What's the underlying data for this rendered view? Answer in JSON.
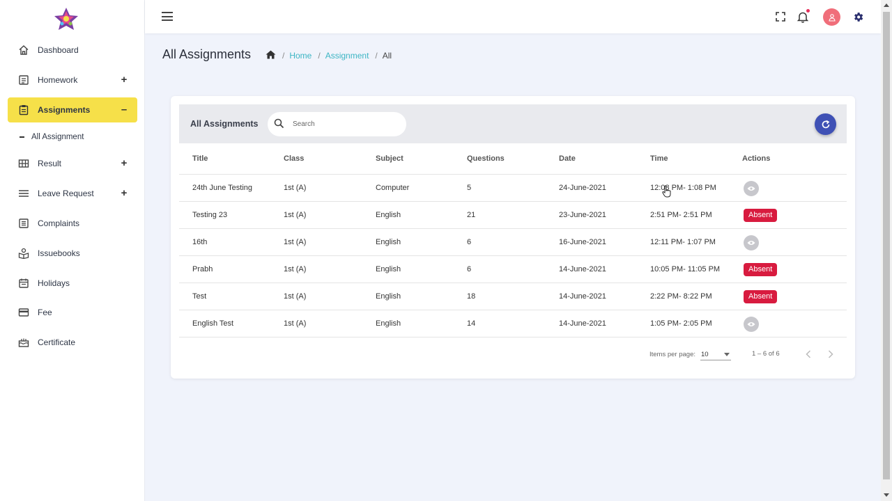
{
  "sidebar": {
    "items": [
      {
        "label": "Dashboard",
        "icon": "home-icon",
        "expandable": false
      },
      {
        "label": "Homework",
        "icon": "homework-icon",
        "expandable": true,
        "toggle": "+"
      },
      {
        "label": "Assignments",
        "icon": "assignment-icon",
        "expandable": true,
        "toggle": "–",
        "active": true
      },
      {
        "label": "Result",
        "icon": "grid-icon",
        "expandable": true,
        "toggle": "+"
      },
      {
        "label": "Leave Request",
        "icon": "lines-icon",
        "expandable": true,
        "toggle": "+"
      },
      {
        "label": "Complaints",
        "icon": "complaint-icon",
        "expandable": false
      },
      {
        "label": "Issuebooks",
        "icon": "books-icon",
        "expandable": false
      },
      {
        "label": "Holidays",
        "icon": "calendar-icon",
        "expandable": false
      },
      {
        "label": "Fee",
        "icon": "card-icon",
        "expandable": false
      },
      {
        "label": "Certificate",
        "icon": "certificate-icon",
        "expandable": false
      }
    ],
    "subitem": {
      "label": "All Assignment"
    },
    "accent_color": "#f6e049"
  },
  "header": {
    "icons": [
      "menu-icon",
      "fullscreen-icon",
      "bell-icon",
      "user-avatar",
      "settings-icon"
    ]
  },
  "page": {
    "title": "All Assignments",
    "breadcrumb": {
      "sep": "/",
      "home": "Home",
      "section": "Assignment",
      "current": "All"
    }
  },
  "card": {
    "title": "All Assignments",
    "search_placeholder": "Search",
    "columns": {
      "title": "Title",
      "class": "Class",
      "subject": "Subject",
      "questions": "Questions",
      "date": "Date",
      "time": "Time",
      "actions": "Actions"
    },
    "rows": [
      {
        "title": "24th June Testing",
        "class": "1st (A)",
        "subject": "Computer",
        "questions": "5",
        "date": "24-June-2021",
        "time": "12:08 PM- 1:08 PM",
        "action": "view"
      },
      {
        "title": "Testing 23",
        "class": "1st (A)",
        "subject": "English",
        "questions": "21",
        "date": "23-June-2021",
        "time": "2:51 PM- 2:51 PM",
        "action": "Absent"
      },
      {
        "title": "16th",
        "class": "1st (A)",
        "subject": "English",
        "questions": "6",
        "date": "16-June-2021",
        "time": "12:11 PM- 1:07 PM",
        "action": "view"
      },
      {
        "title": "Prabh",
        "class": "1st (A)",
        "subject": "English",
        "questions": "6",
        "date": "14-June-2021",
        "time": "10:05 PM- 11:05 PM",
        "action": "Absent"
      },
      {
        "title": "Test",
        "class": "1st (A)",
        "subject": "English",
        "questions": "18",
        "date": "14-June-2021",
        "time": "2:22 PM- 8:22 PM",
        "action": "Absent"
      },
      {
        "title": "English Test",
        "class": "1st (A)",
        "subject": "English",
        "questions": "14",
        "date": "14-June-2021",
        "time": "1:05 PM- 2:05 PM",
        "action": "view"
      }
    ],
    "paginator": {
      "items_per_page_label": "Items per page:",
      "items_per_page_value": "10",
      "range": "1 – 6 of 6"
    },
    "colors": {
      "absent_badge": "#d81b3f",
      "refresh_button": "#3f51b5",
      "link": "#3cb5c4"
    }
  }
}
